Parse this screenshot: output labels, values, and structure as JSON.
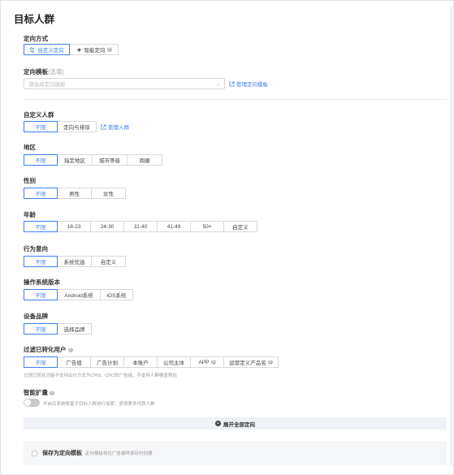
{
  "title": "目标人群",
  "targeting_method": {
    "label": "定向方式",
    "options": [
      "自定义定向",
      "智能定向"
    ]
  },
  "template": {
    "label": "定向模板",
    "optional": "(选填)",
    "placeholder": "请选择定向模板",
    "manage_link": "管理定向模板"
  },
  "custom_audience": {
    "label": "自定义人群",
    "options": [
      "不限",
      "定向与排除"
    ],
    "manage_link": "管理人群"
  },
  "region": {
    "label": "地区",
    "options": [
      "不限",
      "指定地区",
      "城市等级",
      "商圈"
    ]
  },
  "gender": {
    "label": "性别",
    "options": [
      "不限",
      "男性",
      "女性"
    ]
  },
  "age": {
    "label": "年龄",
    "options": [
      "不限",
      "18-23",
      "24-30",
      "31-40",
      "41-49",
      "50+",
      "自定义"
    ]
  },
  "behavior": {
    "label": "行为意向",
    "options": [
      "不限",
      "系统优选",
      "自定义"
    ]
  },
  "os": {
    "label": "操作系统版本",
    "options": [
      "不限",
      "Android系统",
      "iOS系统"
    ]
  },
  "device_brand": {
    "label": "设备品牌",
    "options": [
      "不限",
      "选择品牌"
    ]
  },
  "filter_converted": {
    "label": "过滤已转化用户",
    "options": [
      "不限",
      "广告组",
      "广告计划",
      "本账户",
      "公司主体",
      "APP",
      "运营定义产品名"
    ],
    "hint": "过滤已转化功能不支持出价方式为CPM、CPC的广告组，不支持人群覆盖预估"
  },
  "smart_expand": {
    "label": "智能扩量",
    "hint": "开启后系统将基于目标人群进行探索，获得更多优质人群"
  },
  "expand_all": "展开全部定向",
  "save_template": {
    "label": "保存为定向模板",
    "hint": "定向模板将在广告最终保存时创建"
  },
  "colors": {
    "accent": "#3b7ff5",
    "border": "#d9d9d9"
  }
}
